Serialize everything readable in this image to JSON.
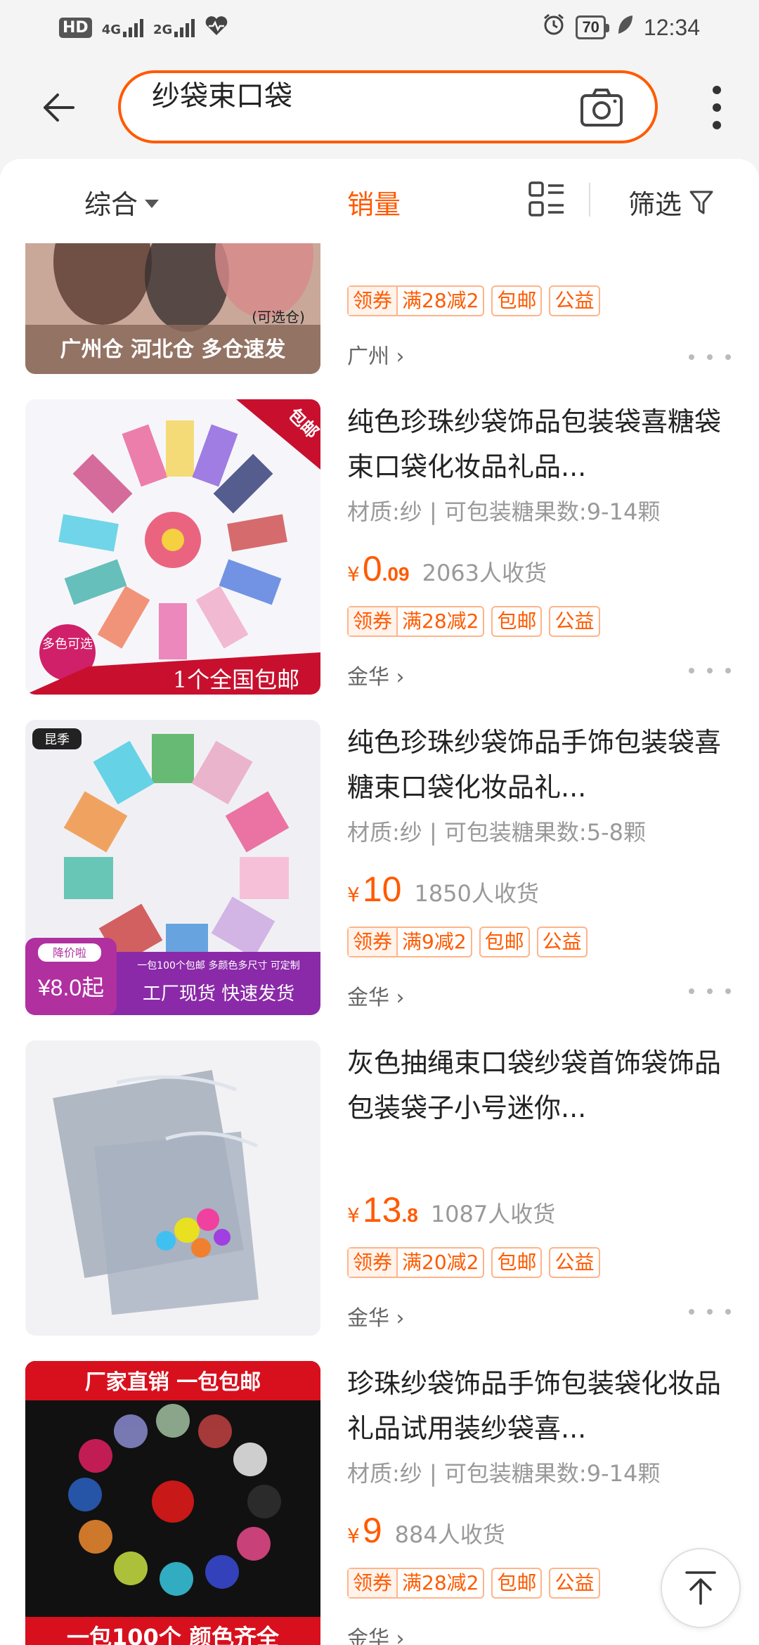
{
  "status_bar": {
    "hd": "HD",
    "net1": "4G",
    "net2": "2G",
    "battery": "70",
    "time": "12:34"
  },
  "search": {
    "query": "纱袋束口袋",
    "back_icon": "arrow-left-icon",
    "camera_icon": "camera-icon",
    "more_icon": "more-vertical-icon"
  },
  "sort_bar": {
    "comprehensive": "综合",
    "sales": "销量",
    "filter": "筛选",
    "active_color": "#ff5a00"
  },
  "items": [
    {
      "title": "",
      "spec": "",
      "price_int": "",
      "price_dec": "",
      "sold": "",
      "coupon_label": "领券",
      "coupon_value": "满28减2",
      "tag_shipping": "包邮",
      "tag_charity": "公益",
      "location": "广州",
      "image_text": "广州仓 河北仓 多仓速发",
      "image_sub": "(可选仓)"
    },
    {
      "title": "纯色珍珠纱袋饰品包装袋喜糖袋束口袋化妆品礼品...",
      "spec": "材质:纱 | 可包装糖果数:9-14颗",
      "price_int": "0",
      "price_dec": ".09",
      "sold": "2063人收货",
      "coupon_label": "领券",
      "coupon_value": "满28减2",
      "tag_shipping": "包邮",
      "tag_charity": "公益",
      "location": "金华",
      "image_text": "1个全国包邮",
      "image_badge": "包邮",
      "image_circle": "多色可选"
    },
    {
      "title": "纯色珍珠纱袋饰品手饰包装袋喜糖束口袋化妆品礼...",
      "spec": "材质:纱 | 可包装糖果数:5-8颗",
      "price_int": "10",
      "price_dec": "",
      "sold": "1850人收货",
      "coupon_label": "领券",
      "coupon_value": "满9减2",
      "tag_shipping": "包邮",
      "tag_charity": "公益",
      "location": "金华",
      "image_brand": "昆季",
      "image_price_tag": "降价啦",
      "image_price": "¥8.0起",
      "image_small": "一包100个包邮 多颜色多尺寸 可定制",
      "image_text": "工厂现货 快速发货"
    },
    {
      "title": "灰色抽绳束口袋纱袋首饰袋饰品包装袋子小号迷你...",
      "spec": "",
      "price_int": "13",
      "price_dec": ".8",
      "sold": "1087人收货",
      "coupon_label": "领券",
      "coupon_value": "满20减2",
      "tag_shipping": "包邮",
      "tag_charity": "公益",
      "location": "金华"
    },
    {
      "title": "珍珠纱袋饰品手饰包装袋化妆品礼品试用装纱袋喜...",
      "spec": "材质:纱 | 可包装糖果数:9-14颗",
      "price_int": "9",
      "price_dec": "",
      "sold": "884人收货",
      "coupon_label": "领券",
      "coupon_value": "满28减2",
      "tag_shipping": "包邮",
      "tag_charity": "公益",
      "location": "金华",
      "image_top": "厂家直销 一包包邮",
      "image_text": "一包100个 颜色齐全"
    }
  ],
  "yen": "¥",
  "back_to_top_icon": "arrow-up-to-top-icon"
}
